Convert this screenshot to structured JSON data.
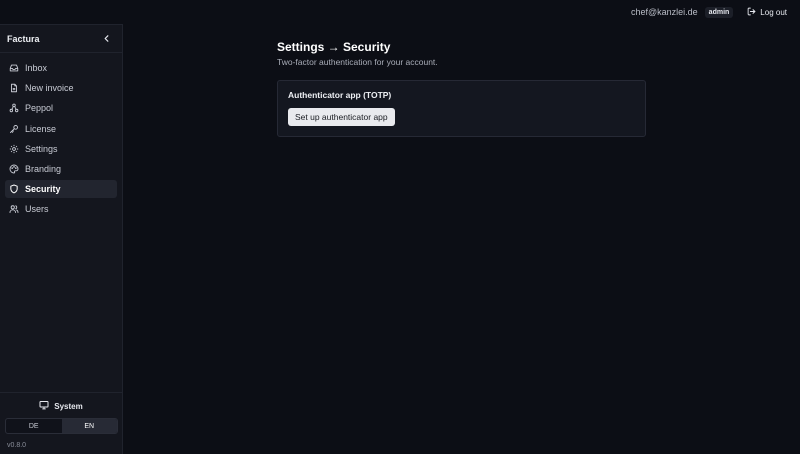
{
  "topbar": {
    "user_email": "chef@kanzlei.de",
    "role": "admin",
    "logout_label": "Log out"
  },
  "sidebar": {
    "brand": "Factura",
    "items": [
      {
        "label": "Inbox",
        "icon": "inbox-icon",
        "active": false
      },
      {
        "label": "New invoice",
        "icon": "file-icon",
        "active": false
      },
      {
        "label": "Peppol",
        "icon": "network-icon",
        "active": false
      },
      {
        "label": "License",
        "icon": "key-icon",
        "active": false
      },
      {
        "label": "Settings",
        "icon": "gear-icon",
        "active": false
      },
      {
        "label": "Branding",
        "icon": "palette-icon",
        "active": false
      },
      {
        "label": "Security",
        "icon": "shield-icon",
        "active": true
      },
      {
        "label": "Users",
        "icon": "users-icon",
        "active": false
      }
    ],
    "theme_label": "System",
    "languages": [
      {
        "label": "DE",
        "active": false
      },
      {
        "label": "EN",
        "active": true
      }
    ],
    "version": "v0.8.0"
  },
  "main": {
    "title": "Settings → Security",
    "subtitle": "Two-factor authentication for your account.",
    "card": {
      "title": "Authenticator app (TOTP)",
      "button_label": "Set up authenticator app"
    }
  },
  "colors": {
    "background": "#0c0e15",
    "sidebar": "#14161e",
    "active_item": "#22252f",
    "button": "#e9eaee"
  }
}
